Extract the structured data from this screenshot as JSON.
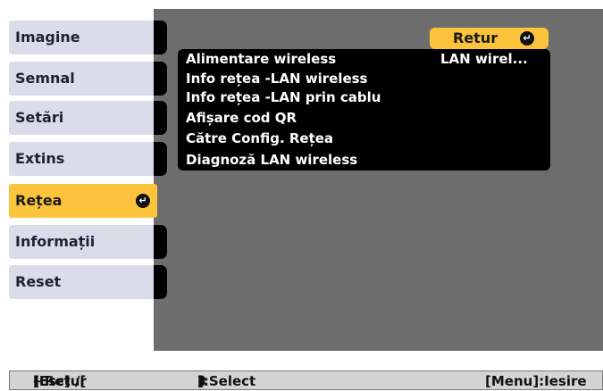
{
  "sidebar": {
    "items": [
      {
        "label": "Imagine",
        "active": false
      },
      {
        "label": "Semnal",
        "active": false
      },
      {
        "label": "Setări",
        "active": false
      },
      {
        "label": "Extins",
        "active": false
      },
      {
        "label": "Rețea",
        "active": true
      },
      {
        "label": "Informații",
        "active": false
      },
      {
        "label": "Reset",
        "active": false
      }
    ],
    "active_icon": "enter-icon"
  },
  "main": {
    "retur_label": "Retur",
    "retur_icon": "enter-icon",
    "items": [
      {
        "label": "Alimentare wireless",
        "value": "LAN wirel..."
      },
      {
        "label": "Info rețea -LAN wireless"
      },
      {
        "label": "Info rețea -LAN prin cablu"
      },
      {
        "label": "Afișare cod QR"
      },
      {
        "label": "Către Config. Rețea"
      },
      {
        "label": "Diagnoză LAN wireless"
      }
    ]
  },
  "footer": {
    "esc_retur": "[Esc] /[",
    "esc_retur_icon": "enter-icon",
    "esc_retur_tail": "]:Retur",
    "select_prefix": "[",
    "select_icon": "up-down-icon",
    "select_tail": "]:Select",
    "menu_exit": "[Menu]:Iesire"
  },
  "colors": {
    "panel": "#6d6d6d",
    "sidebar_item": "#d8dde9",
    "highlight": "#fcc33c",
    "list_bg": "#000000",
    "footer_bg": "#d4d4d4"
  }
}
